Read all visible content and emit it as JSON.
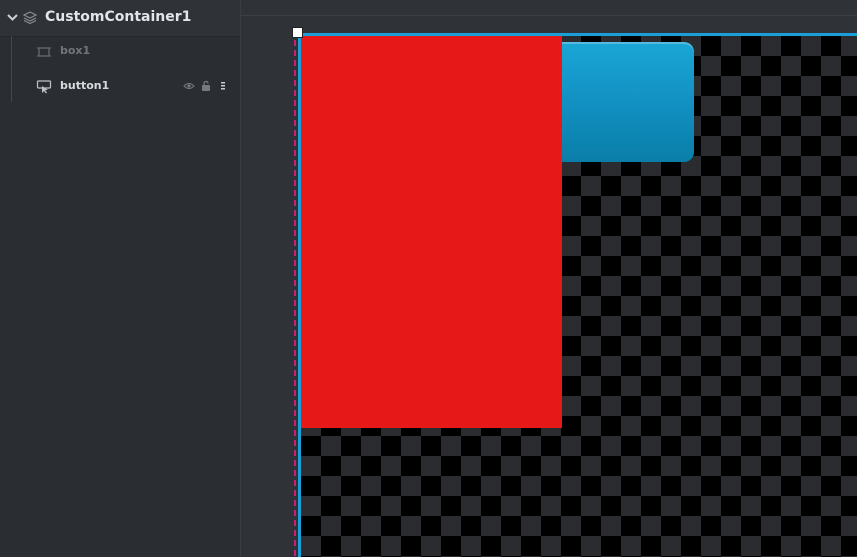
{
  "tree": {
    "root_label": "CustomContainer1",
    "items": [
      {
        "label": "box1",
        "icon": "box-outline-icon"
      },
      {
        "label": "button1",
        "icon": "button-cursor-icon",
        "actions": [
          "eye-icon",
          "lock-icon",
          "drag-handle-icon"
        ]
      }
    ]
  },
  "colors": {
    "selection_border": "#1b9fd9",
    "box1_fill": "#e71818",
    "button1_fill": "#118fc0",
    "guide_dash": "#c8207a"
  }
}
